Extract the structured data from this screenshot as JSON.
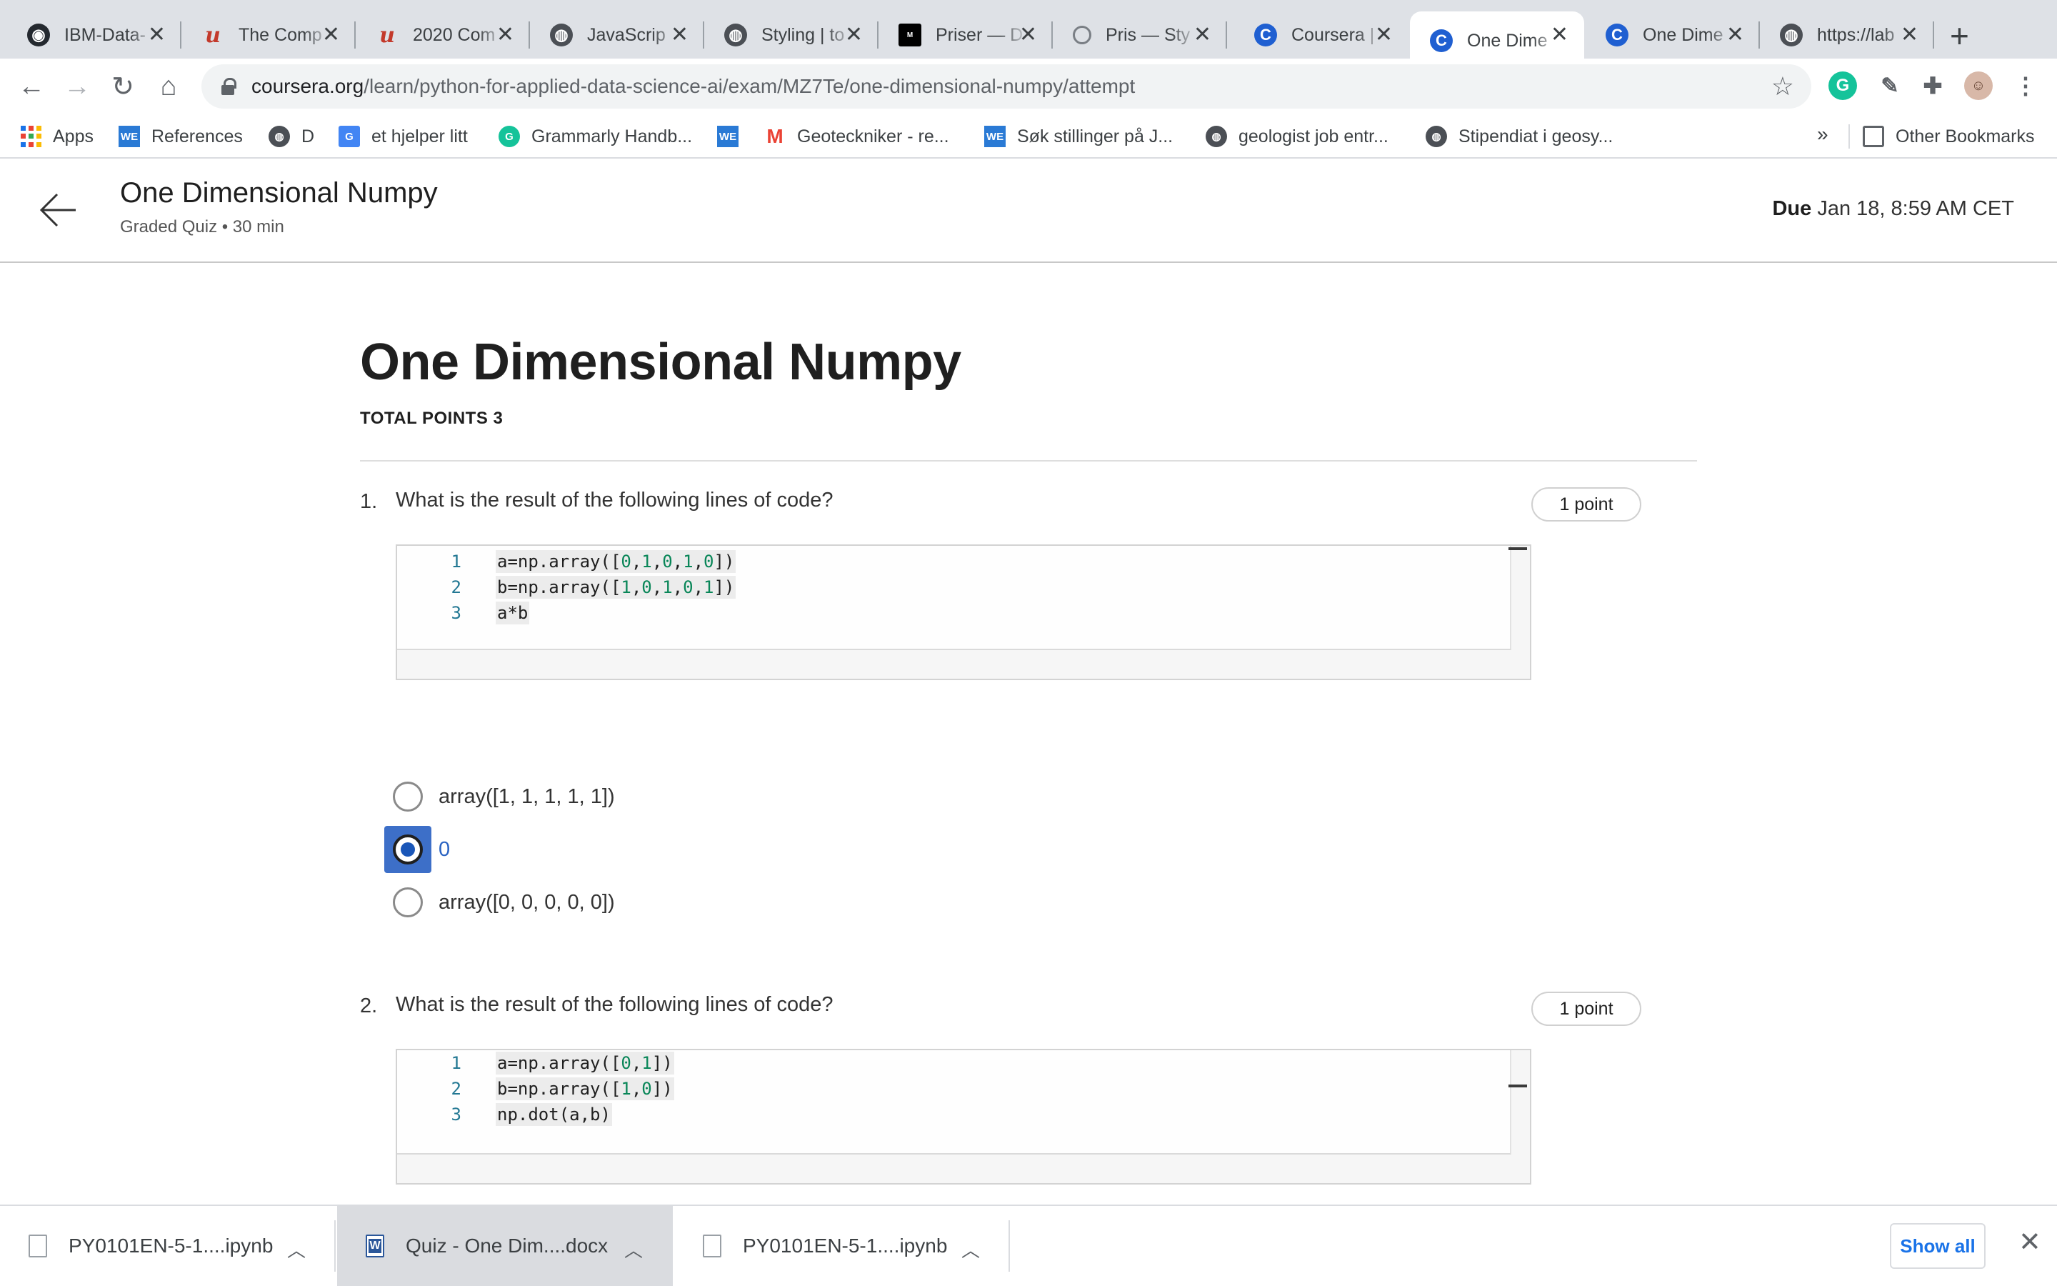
{
  "browser": {
    "tabs": [
      {
        "title": "IBM-Data-",
        "icon": "github-icon"
      },
      {
        "title": "The Comp",
        "icon": "udemy-icon"
      },
      {
        "title": "2020 Com",
        "icon": "udemy-icon"
      },
      {
        "title": "JavaScrip",
        "icon": "globe-icon"
      },
      {
        "title": "Styling | to",
        "icon": "globe-icon"
      },
      {
        "title": "Priser — D",
        "icon": "mood-icon"
      },
      {
        "title": "Pris — Sty",
        "icon": "outline-icon"
      },
      {
        "title": "Coursera |",
        "icon": "coursera-icon"
      },
      {
        "title": "One Dime",
        "icon": "coursera-icon",
        "active": true
      },
      {
        "title": "One Dime",
        "icon": "coursera-icon"
      },
      {
        "title": "https://lab",
        "icon": "globe-icon"
      }
    ],
    "url_host": "coursera.org",
    "url_path": "/learn/python-for-applied-data-science-ai/exam/MZ7Te/one-dimensional-numpy/attempt",
    "bookmarks": [
      {
        "label": "Apps"
      },
      {
        "label": "References"
      },
      {
        "label": "D"
      },
      {
        "label": "et hjelper litt"
      },
      {
        "label": "Grammarly Handb..."
      },
      {
        "label": ""
      },
      {
        "label": "Geoteckniker - re..."
      },
      {
        "label": "Søk stillinger på J..."
      },
      {
        "label": "geologist job entr..."
      },
      {
        "label": "Stipendiat i geosy..."
      }
    ],
    "bookmarks_more": "»",
    "other_bookmarks": "Other Bookmarks"
  },
  "header": {
    "title": "One Dimensional Numpy",
    "subtitle": "Graded Quiz • 30 min",
    "due_label": "Due",
    "due_value": "Jan 18, 8:59 AM CET"
  },
  "quiz": {
    "title": "One Dimensional Numpy",
    "total_points": "TOTAL POINTS 3",
    "questions": [
      {
        "number": "1.",
        "text": "What is the result of the following lines of code?",
        "points": "1 point",
        "code": [
          {
            "n": "1",
            "text": "a=np.array([0,1,0,1,0])"
          },
          {
            "n": "2",
            "text": "b=np.array([1,0,1,0,1])"
          },
          {
            "n": "3",
            "text": "a*b"
          }
        ],
        "options": [
          {
            "label": "array([1, 1, 1, 1, 1])",
            "selected": false
          },
          {
            "label": "0",
            "selected": true
          },
          {
            "label": "array([0, 0, 0, 0, 0])",
            "selected": false
          }
        ]
      },
      {
        "number": "2.",
        "text": "What is the result of the following lines of code?",
        "points": "1 point",
        "code": [
          {
            "n": "1",
            "text": "a=np.array([0,1])"
          },
          {
            "n": "2",
            "text": "b=np.array([1,0])"
          },
          {
            "n": "3",
            "text": "np.dot(a,b)"
          }
        ]
      }
    ]
  },
  "downloads": {
    "items": [
      {
        "name": "PY0101EN-5-1....ipynb"
      },
      {
        "name": "Quiz - One Dim....docx"
      },
      {
        "name": "PY0101EN-5-1....ipynb"
      }
    ],
    "show_all": "Show all"
  }
}
